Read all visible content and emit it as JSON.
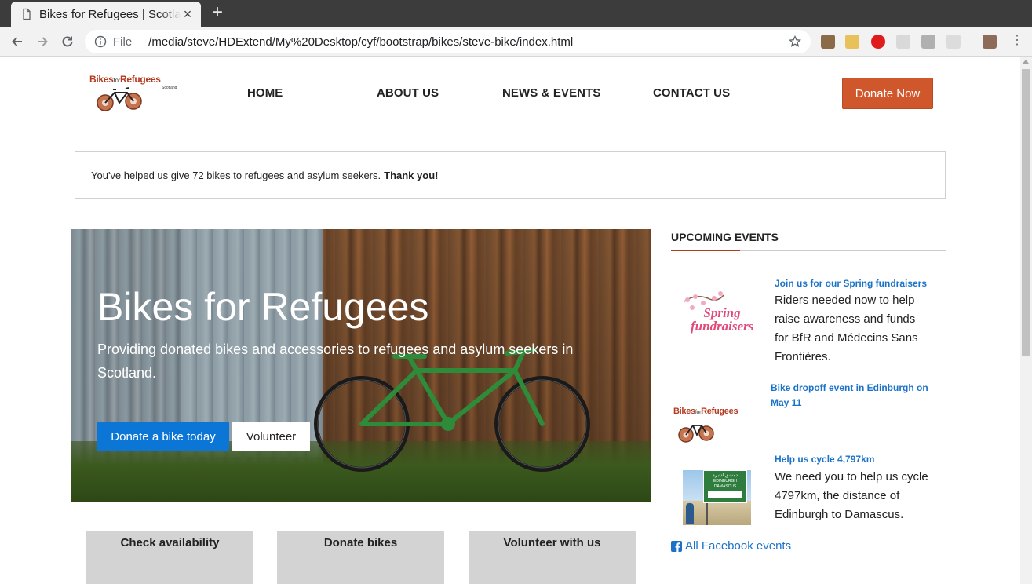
{
  "browser": {
    "tab_title": "Bikes for Refugees | Scotland",
    "omnibox_scheme": "File",
    "omnibox_url": "/media/steve/HDExtend/My%20Desktop/cyf/bootstrap/bikes/steve-bike/index.html"
  },
  "header": {
    "logo_main": "Bikes",
    "logo_for": "for",
    "logo_refugees": "Refugees",
    "logo_sub": "Scotland",
    "nav": [
      "HOME",
      "ABOUT US",
      "NEWS & EVENTS",
      "CONTACT US"
    ],
    "donate_label": "Donate Now"
  },
  "alert": {
    "text": "You've helped us give 72 bikes to refugees and asylum seekers.",
    "thanks": "Thank you!"
  },
  "hero": {
    "title": "Bikes for Refugees",
    "subtitle": "Providing donated bikes and accessories to refugees and asylum seekers in Scotland.",
    "primary_button": "Donate a bike today",
    "secondary_button": "Volunteer"
  },
  "sidebar": {
    "title": "UPCOMING EVENTS",
    "events": [
      {
        "title": "Join us for our Spring fundraisers",
        "desc": "Riders needed now to help raise awareness and funds for BfR and Médecins Sans Frontières.",
        "thumb_text": "Spring fundraisers"
      },
      {
        "title": "Bike dropoff event in Edinburgh on May 11",
        "desc": ""
      },
      {
        "title": "Help us cycle 4,797km",
        "desc": "We need you to help us cycle 4797km, the distance of Edinburgh to Damascus.",
        "sign_top": "دمشق ادنبرة",
        "sign_bottom": "EDINBURGH DAMASCUS"
      }
    ],
    "fb_link": "All Facebook events"
  },
  "cards": [
    "Check availability",
    "Donate bikes",
    "Volunteer with us"
  ],
  "colors": {
    "brand": "#d0572c",
    "link": "#1a73c8",
    "primary": "#0b76d6"
  }
}
